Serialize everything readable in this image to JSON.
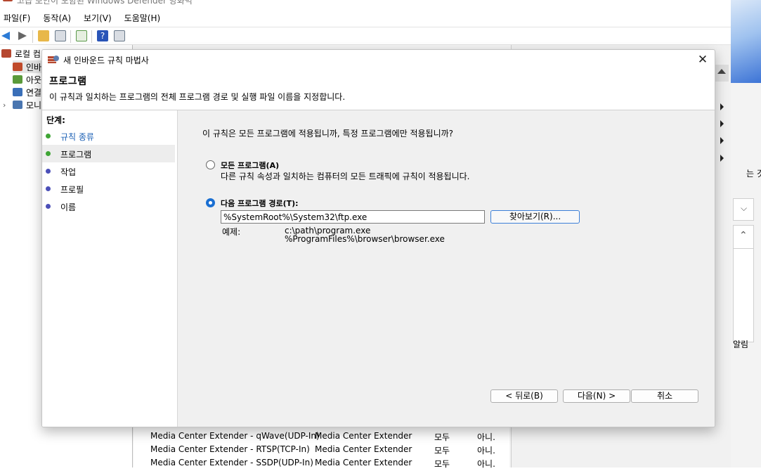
{
  "background_window": {
    "title": "고급 보안이 포함된 Windows Defender 방화벽",
    "menu": [
      "파일(F)",
      "동작(A)",
      "보기(V)",
      "도움말(H)"
    ],
    "tree": [
      "로컬 컴",
      "인바",
      "아웃",
      "연결",
      "모니"
    ],
    "rows": [
      {
        "name": "Media Center Extender - qWave(UDP-In)",
        "group": "Media Center Extender",
        "profile": "모두",
        "enabled": "아니."
      },
      {
        "name": "Media Center Extender - RTSP(TCP-In)",
        "group": "Media Center Extender",
        "profile": "모두",
        "enabled": "아니."
      },
      {
        "name": "Media Center Extender - SSDP(UDP-In)",
        "group": "Media Center Extender",
        "profile": "모두",
        "enabled": "아니."
      }
    ],
    "right_partial_texts": [
      "는 것",
      "알림"
    ]
  },
  "dialog": {
    "title": "새 인바운드 규칙 마법사",
    "header_title": "프로그램",
    "header_subtitle": "이 규칙과 일치하는 프로그램의 전체 프로그램 경로 및 실행 파일 이름을 지정합니다.",
    "steps_title": "단계:",
    "steps": [
      {
        "label": "규칙 종류",
        "state": "done",
        "color": "#3fa535"
      },
      {
        "label": "프로그램",
        "state": "current",
        "color": "#3fa535"
      },
      {
        "label": "작업",
        "state": "pending",
        "color": "#4b4fb8"
      },
      {
        "label": "프로필",
        "state": "pending",
        "color": "#4b4fb8"
      },
      {
        "label": "이름",
        "state": "pending",
        "color": "#4b4fb8"
      }
    ],
    "question": "이 규칙은 모든 프로그램에 적용됩니까, 특정 프로그램에만 적용됩니까?",
    "option_all": {
      "label": "모든 프로그램(A)",
      "description": "다른 규칙 속성과 일치하는 컴퓨터의 모든 트래픽에 규칙이 적용됩니다.",
      "selected": false
    },
    "option_path": {
      "label": "다음 프로그램 경로(T):",
      "selected": true
    },
    "path_value": "%SystemRoot%\\System32\\ftp.exe",
    "browse_label": "찾아보기(R)...",
    "example_label": "예제:",
    "example_1": "c:\\path\\program.exe",
    "example_2": "%ProgramFiles%\\browser\\browser.exe",
    "buttons": {
      "back": "< 뒤로(B)",
      "next": "다음(N) >",
      "cancel": "취소"
    }
  },
  "colors": {
    "accent": "#1a6fd2",
    "step_done": "#3fa535",
    "step_pending": "#4b4fb8"
  }
}
